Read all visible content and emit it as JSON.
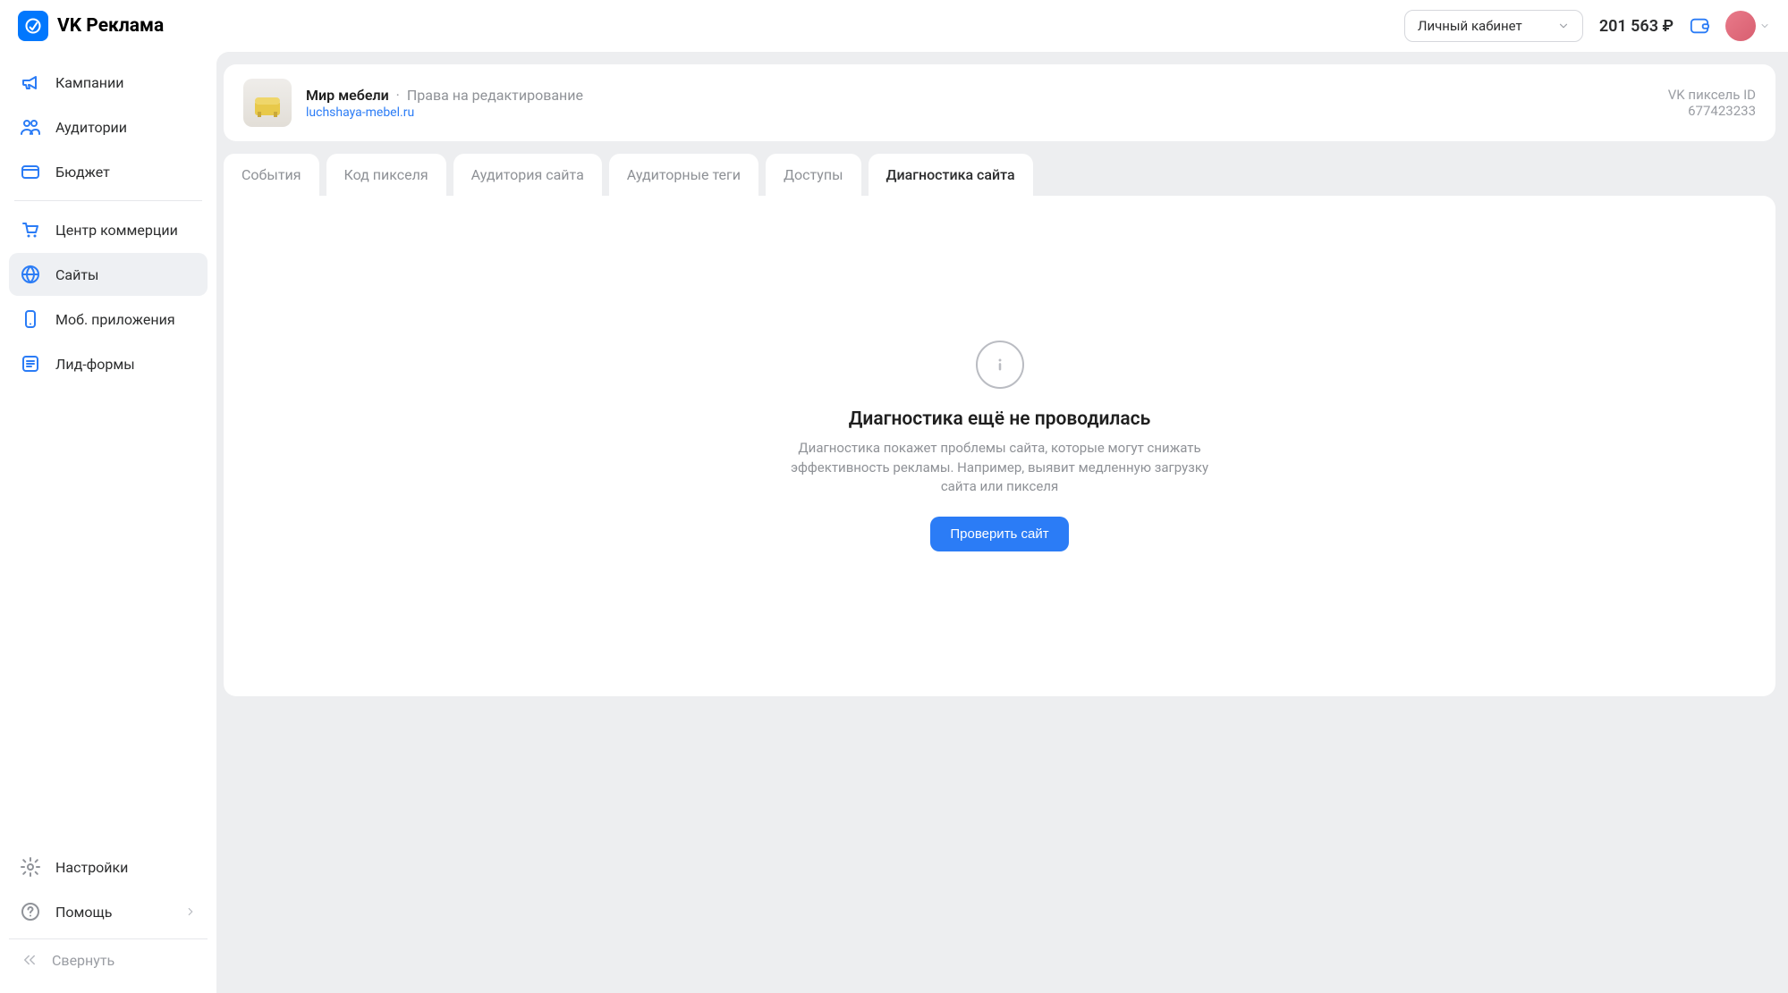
{
  "brand": {
    "name": "VK Реклама"
  },
  "header": {
    "account_selector": "Личный кабинет",
    "balance": "201 563 ₽"
  },
  "sidebar": {
    "items_top": [
      {
        "label": "Кампании",
        "icon": "megaphone-icon"
      },
      {
        "label": "Аудитории",
        "icon": "users-icon"
      },
      {
        "label": "Бюджет",
        "icon": "budget-icon"
      }
    ],
    "items_mid": [
      {
        "label": "Центр коммерции",
        "icon": "cart-icon"
      },
      {
        "label": "Сайты",
        "icon": "globe-icon",
        "active": true
      },
      {
        "label": "Моб. приложения",
        "icon": "phone-icon"
      },
      {
        "label": "Лид-формы",
        "icon": "form-icon"
      }
    ],
    "items_bottom": [
      {
        "label": "Настройки",
        "icon": "gear-icon"
      },
      {
        "label": "Помощь",
        "icon": "help-icon"
      }
    ],
    "collapse": "Свернуть"
  },
  "site": {
    "name": "Мир мебели",
    "separator": "·",
    "permission": "Права на редактирование",
    "url": "luchshaya-mebel.ru",
    "pixel_label": "VK пиксель ID",
    "pixel_id": "677423233"
  },
  "tabs": [
    {
      "label": "События"
    },
    {
      "label": "Код пикселя"
    },
    {
      "label": "Аудитория сайта"
    },
    {
      "label": "Аудиторные теги"
    },
    {
      "label": "Доступы"
    },
    {
      "label": "Диагностика сайта",
      "active": true
    }
  ],
  "empty": {
    "title": "Диагностика ещё не проводилась",
    "description": "Диагностика покажет проблемы сайта, которые могут снижать эффективность рекламы. Например, выявит медленную загрузку сайта или пикселя",
    "button": "Проверить сайт"
  }
}
